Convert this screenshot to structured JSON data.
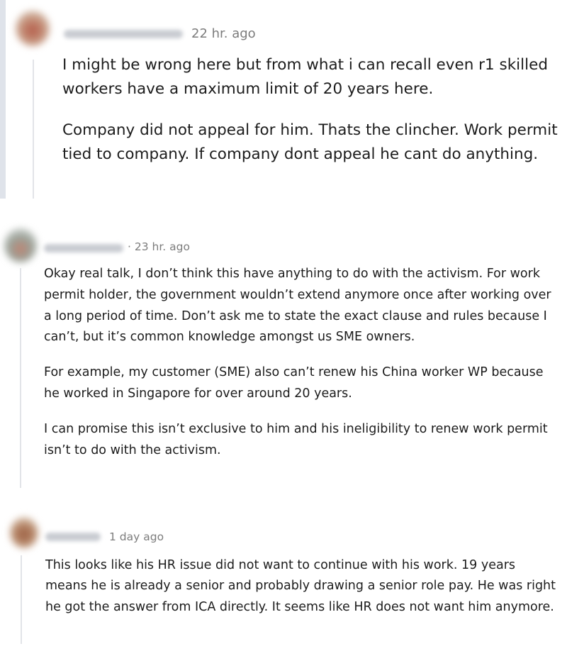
{
  "comments": [
    {
      "time": "22 hr. ago",
      "paragraphs": [
        "I might be wrong here but from what i can recall even r1 skilled workers have a maximum limit of 20 years here.",
        "Company did not appeal for him. Thats the clincher. Work permit tied to company. If company dont appeal he cant do anything."
      ]
    },
    {
      "time": "· 23 hr. ago",
      "paragraphs": [
        "Okay real talk, I don’t think this have anything to do with the activism. For work permit holder, the government wouldn’t extend anymore once after working over a long period of time. Don’t ask me to state the exact clause and rules because I can’t, but it’s common knowledge amongst us SME owners.",
        "For example, my customer (SME) also can’t renew his China worker WP because he worked in Singapore for over around 20 years.",
        "I can promise this isn’t exclusive to him and his ineligibility to renew work permit isn’t to do with the activism."
      ]
    },
    {
      "time": "1 day ago",
      "paragraphs": [
        "This looks like his HR issue did not want to continue with his work. 19 years means he is already a senior and probably drawing a senior role pay. He was right he got the answer from ICA directly. It seems like HR does not want him anymore."
      ]
    }
  ]
}
